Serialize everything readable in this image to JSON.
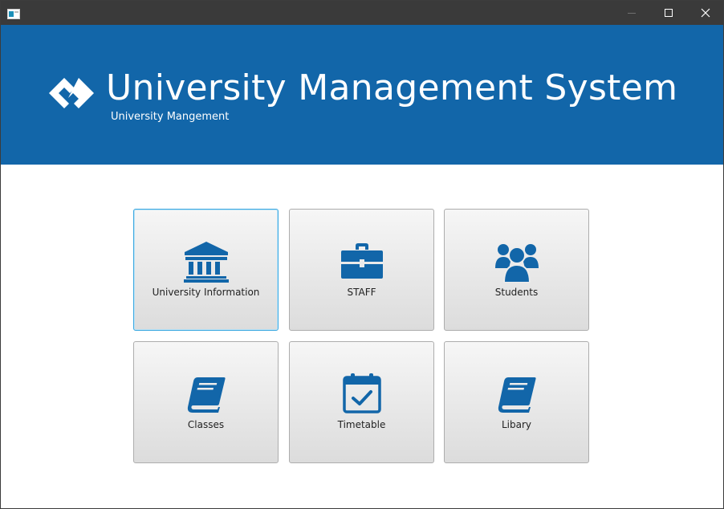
{
  "window": {
    "controls": [
      "minimize",
      "maximize",
      "close"
    ]
  },
  "header": {
    "title": "University Management System",
    "subtitle": "University Mangement",
    "background_color": "#1266a9"
  },
  "tiles": [
    {
      "label": "University Information",
      "icon": "bank-icon",
      "focused": true
    },
    {
      "label": "STAFF",
      "icon": "briefcase-icon"
    },
    {
      "label": "Students",
      "icon": "users-icon"
    },
    {
      "label": "Classes",
      "icon": "book-icon"
    },
    {
      "label": "Timetable",
      "icon": "calendar-check-icon"
    },
    {
      "label": "Libary",
      "icon": "book-icon"
    }
  ],
  "colors": {
    "accent": "#1266a9",
    "icon": "#1266a9",
    "focus_border": "#3aa7e0",
    "titlebar": "#3a3a3a"
  }
}
